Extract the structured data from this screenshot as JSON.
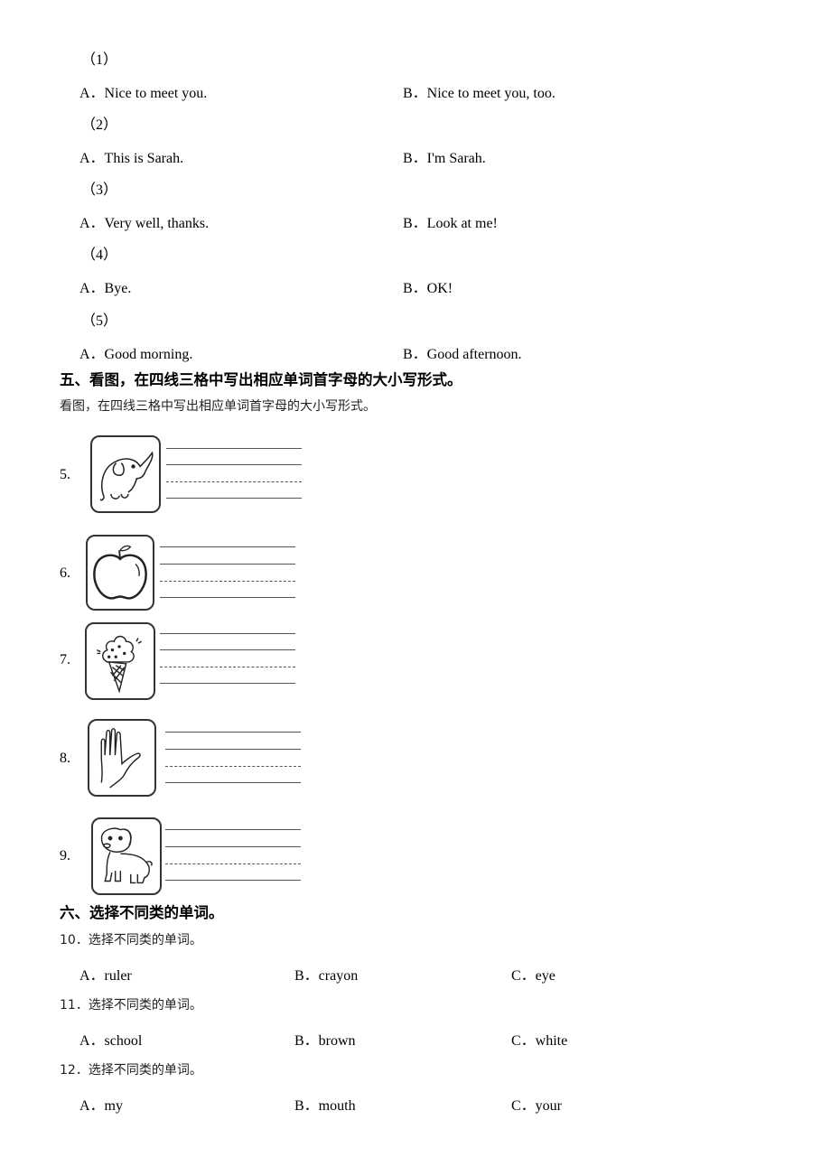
{
  "listening": {
    "questions": [
      {
        "num": "（1）",
        "a": "A．Nice to meet you.",
        "b": "B．Nice to meet you, too."
      },
      {
        "num": "（2）",
        "a": "A．This is Sarah.",
        "b": "B．I'm Sarah."
      },
      {
        "num": "（3）",
        "a": "A．Very well, thanks.",
        "b": "B．Look at me!"
      },
      {
        "num": "（4）",
        "a": "A．Bye.",
        "b": "B．OK!"
      },
      {
        "num": "（5）",
        "a": "A．Good morning.",
        "b": "B．Good afternoon."
      }
    ]
  },
  "section5": {
    "title": "五、看图，在四线三格中写出相应单词首字母的大小写形式。",
    "instruction": "看图，在四线三格中写出相应单词首字母的大小写形式。",
    "items": [
      {
        "num": "5.",
        "icon": "elephant-icon"
      },
      {
        "num": "6.",
        "icon": "apple-icon"
      },
      {
        "num": "7.",
        "icon": "ice-cream-icon"
      },
      {
        "num": "8.",
        "icon": "hand-icon"
      },
      {
        "num": "9.",
        "icon": "dog-icon"
      }
    ]
  },
  "section6": {
    "title": "六、选择不同类的单词。",
    "questions": [
      {
        "prompt": "10．选择不同类的单词。",
        "a": "A．ruler",
        "b": "B．crayon",
        "c": "C．eye"
      },
      {
        "prompt": "11．选择不同类的单词。",
        "a": "A．school",
        "b": "B．brown",
        "c": "C．white"
      },
      {
        "prompt": "12．选择不同类的单词。",
        "a": "A．my",
        "b": "B．mouth",
        "c": "C．your"
      }
    ]
  }
}
